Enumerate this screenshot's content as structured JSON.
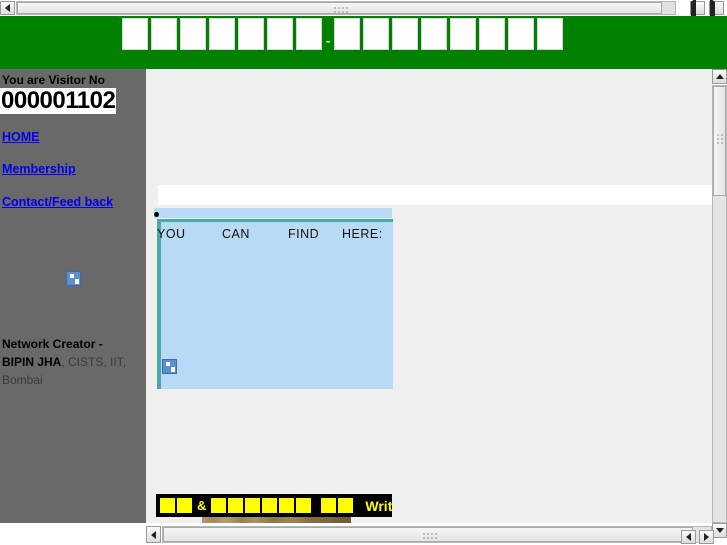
{
  "window": {
    "background_color": "#ffffff"
  },
  "top_scrollbar": {
    "name": "outer-horizontal-scrollbar",
    "left_arrow": "◄",
    "right_arrow": "►"
  },
  "banner": {
    "background_color": "#008000",
    "separator": "-",
    "placeholder_count_left": 7,
    "placeholder_count_right": 8,
    "placeholders_left": [
      "",
      "",
      "",
      "",
      "",
      "",
      ""
    ],
    "placeholders_right": [
      "",
      "",
      "",
      "",
      "",
      "",
      "",
      ""
    ]
  },
  "sidebar": {
    "background_color": "#696969",
    "visitor_label": "You are Visitor No",
    "visitor_count": "000001102",
    "links": [
      {
        "label": "HOME",
        "id": "home"
      },
      {
        "label": "Membership",
        "id": "membership"
      },
      {
        "label": "Contact/Feed back",
        "id": "contact"
      }
    ],
    "link_color": "#0000ee",
    "broken_image_icon": "broken-image-icon",
    "creator": {
      "prefix": "Network Creator -",
      "name": "BIPIN JHA",
      "affiliation": ", CISTS, IIT,",
      "location": "Bombai"
    }
  },
  "main": {
    "background_color": "#efefef",
    "content_heading_words": [
      "YOU",
      "CAN",
      "FIND",
      "HERE:"
    ],
    "teal_border_color": "#4aa8a8",
    "content_background_color": "#b8daf4",
    "broken_image_icon": "broken-image-icon",
    "bottom_bar": {
      "background_color": "#000000",
      "text_color": "#ffff00",
      "ampersand": "&",
      "write_to_label": "Write to",
      "yellow_block_group_1": 2,
      "yellow_block_group_2": 6,
      "yellow_block_group_3": 2
    },
    "wood_banner": "wood-texture-banner"
  },
  "inner_scrollbar": {
    "name": "inner-horizontal-scrollbar",
    "left_arrow": "◄"
  },
  "vertical_scrollbar": {
    "name": "outer-vertical-scrollbar",
    "up_arrow": "▲",
    "down_arrow": "▼"
  }
}
